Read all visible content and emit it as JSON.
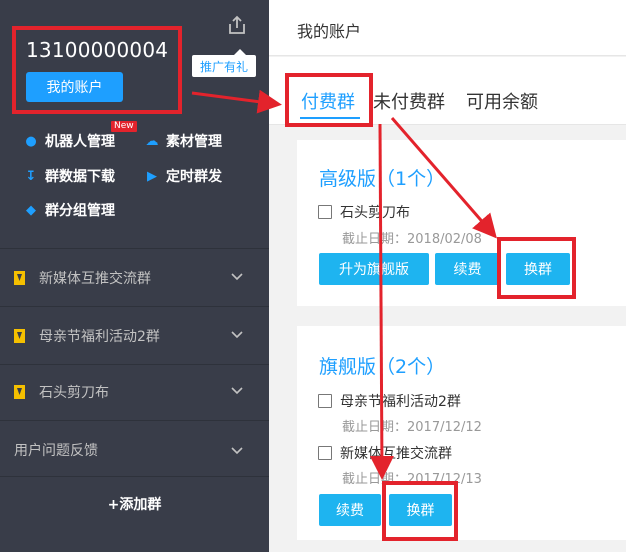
{
  "sidebar": {
    "phone": "13100000004",
    "account_button": "我的账户",
    "promo_tip": "推广有礼",
    "new_badge": "New",
    "menu": [
      {
        "label": "机器人管理",
        "icon": "robot-icon"
      },
      {
        "label": "素材管理",
        "icon": "cloud-icon"
      },
      {
        "label": "群数据下载",
        "icon": "download-icon"
      },
      {
        "label": "定时群发",
        "icon": "speaker-icon"
      },
      {
        "label": "群分组管理",
        "icon": "layers-icon"
      }
    ],
    "groups": [
      {
        "label": "新媒体互推交流群"
      },
      {
        "label": "母亲节福利活动2群"
      },
      {
        "label": "石头剪刀布"
      }
    ],
    "feedback": "用户问题反馈",
    "add_group": "+添加群"
  },
  "header": {
    "title": "我的账户"
  },
  "tabs": [
    {
      "label": "付费群",
      "active": true
    },
    {
      "label": "未付费群",
      "active": false
    },
    {
      "label": "可用余额",
      "active": false
    }
  ],
  "cards": [
    {
      "title": "高级版（1个）",
      "groups": [
        {
          "name": "石头剪刀布",
          "expire": "截止日期：2018/02/08"
        }
      ],
      "buttons": [
        "升为旗舰版",
        "续费",
        "换群"
      ]
    },
    {
      "title": "旗舰版（2个）",
      "groups": [
        {
          "name": "母亲节福利活动2群",
          "expire": "截止日期：2017/12/12"
        },
        {
          "name": "新媒体互推交流群",
          "expire": "截止日期：2017/12/13"
        }
      ],
      "buttons": [
        "续费",
        "换群"
      ]
    }
  ],
  "colors": {
    "sidebar_bg": "#393d49",
    "accent": "#1e9fff",
    "button": "#1eb4f0",
    "highlight": "#e3232c",
    "group_icon": "#f5c000"
  }
}
